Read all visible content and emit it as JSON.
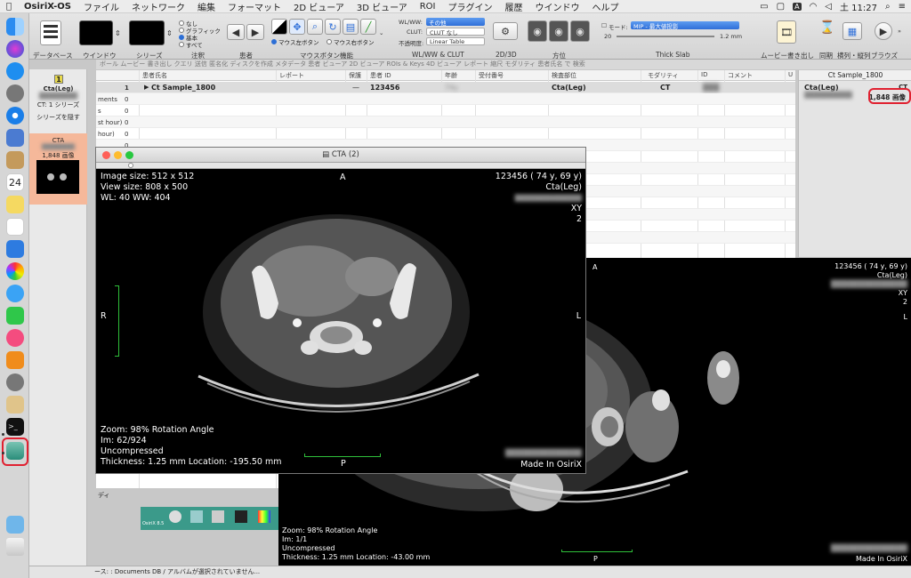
{
  "menubar": {
    "app": "OsiriX-OS",
    "items": [
      "ファイル",
      "ネットワーク",
      "編集",
      "フォーマット",
      "2D ビューア",
      "3D ビューア",
      "ROI",
      "プラグイン",
      "履歴",
      "ウインドウ",
      "ヘルプ"
    ],
    "clock": "土 11:27",
    "input_badge": "A"
  },
  "toolbar": {
    "labels": {
      "database": "データベース",
      "window": "ウインドウ",
      "series": "シリーズ",
      "annotation": "注釈",
      "patient": "患者",
      "mouse": "マウスボタン機能",
      "wlww": "WL/WW & CLUT",
      "view2d3d": "2D/3D",
      "orientation": "方位",
      "thickslab": "Thick Slab",
      "movie_export": "ムービー書き出し",
      "sync": "同期",
      "tile": "横列・縦列",
      "browser": "ブラウズ"
    },
    "annotation_options": [
      "なし",
      "グラフィック",
      "基本",
      "すべて"
    ],
    "annotation_selected": "基本",
    "mouse_options": [
      "マウス左ボタン",
      "マウス右ボタン"
    ],
    "wlww_label": "WL/WW:",
    "wlww_value": "その他",
    "clut_label": "CLUT:",
    "clut_value": "CLUT なし",
    "opacity_label": "不透明度:",
    "opacity_value": "Linear Table",
    "mode_label": "モード:",
    "mode_value": "MIP - 最大値投影",
    "slab_count": "20",
    "slab_thickness": "1.2 mm"
  },
  "tabstrip": "ボール  ムービー  書き出し  クエリ  送信  匿名化  ディスクを作成  メタデータ  患者      ビューア  2D ビューア  ROIs & Keys  4D ビューア  レポート                  縮尺                                        モダリティ                                                     患者氏名 で 検索",
  "leftpanel": {
    "badge": "1",
    "title": "Cta(Leg)",
    "ct_series": "CT: 1 シリーズ",
    "hide_series": "シリーズを隠す",
    "thumb_title": "CTA",
    "thumb_count": "1,848 画像"
  },
  "table": {
    "headers": [
      "患者氏名",
      "レポート",
      "保護",
      "患者 ID",
      "年齢",
      "受付番号",
      "検査部位",
      "モダリティ",
      "ID",
      "コメント",
      "U"
    ],
    "row": {
      "index": "1",
      "name": "Ct Sample_1800",
      "report": "",
      "lock": "—",
      "patient_id": "123456",
      "age": "74y",
      "accession": "",
      "body_part": "Cta(Leg)",
      "modality": "CT",
      "id": "",
      "comment": ""
    },
    "stubs": [
      {
        "label": "",
        "count": "1"
      },
      {
        "label": "ments",
        "count": "0"
      },
      {
        "label": "s",
        "count": "0"
      },
      {
        "label": "",
        "count": "0"
      },
      {
        "label": "st hour)",
        "count": "0"
      },
      {
        "label": "hour)",
        "count": "0"
      }
    ]
  },
  "rightpanel": {
    "header": "Ct Sample_1800",
    "body_part": "Cta(Leg)",
    "modality": "CT",
    "count": "1,848 画像"
  },
  "viewer1": {
    "title": "CTA (2)",
    "top_left": [
      "Image size: 512 x 512",
      "View size: 808 x 500",
      "WL: 40 WW: 404"
    ],
    "top_center": "A",
    "top_right": [
      "123456 ( 74 y, 69 y)",
      "Cta(Leg)",
      "",
      "XY",
      "2"
    ],
    "left_marker": "R",
    "right_marker": "L",
    "bottom_center": "P",
    "bottom_left": [
      "Zoom: 98% Rotation Angle",
      "Im: 62/924",
      "Uncompressed",
      "Thickness: 1.25 mm Location: -195.50 mm"
    ],
    "bottom_right": "Made In OsiriX"
  },
  "viewer2": {
    "top_center": "A",
    "top_right": [
      "123456 ( 74 y, 69 y)",
      "Cta(Leg)",
      "",
      "XY",
      "2"
    ],
    "right_marker": "L",
    "bottom_center": "P",
    "bottom_left": [
      "Zoom: 98% Rotation Angle",
      "Im: 1/1",
      "Uncompressed",
      "Thickness: 1.25 mm Location: -43.00 mm"
    ],
    "bottom_right": "Made In OsiriX"
  },
  "small_labels": {
    "di": "ディ",
    "widget_title": "OsiriX 8.5"
  },
  "statusbar": "ース: : Documents DB / アルバムが選択されていません...",
  "colors": {
    "selection_orange": "#f5b89a",
    "accent_blue": "#2f6fd8",
    "annotation_red": "#e02030",
    "ruler_green": "#2fbf3a"
  }
}
